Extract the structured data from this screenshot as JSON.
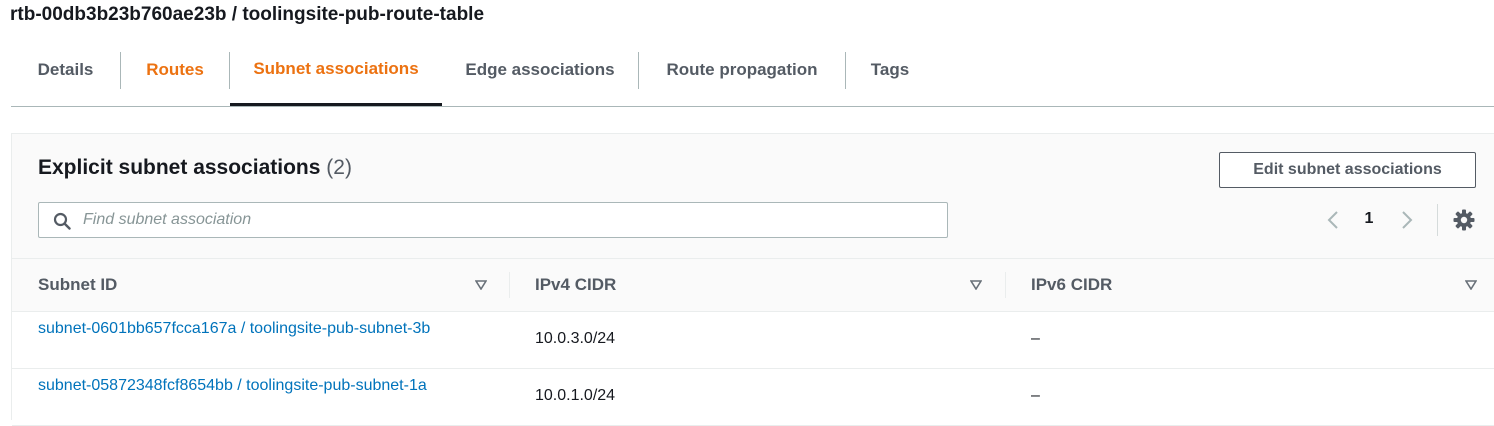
{
  "page": {
    "title": "rtb-00db3b23b760ae23b / toolingsite-pub-route-table"
  },
  "tabs": [
    {
      "label": "Details",
      "state": "default"
    },
    {
      "label": "Routes",
      "state": "highlighted"
    },
    {
      "label": "Subnet associations",
      "state": "active"
    },
    {
      "label": "Edge associations",
      "state": "default"
    },
    {
      "label": "Route propagation",
      "state": "default"
    },
    {
      "label": "Tags",
      "state": "default"
    }
  ],
  "section": {
    "title": "Explicit subnet associations",
    "count": "(2)",
    "edit_button": "Edit subnet associations"
  },
  "search": {
    "placeholder": "Find subnet association",
    "value": "",
    "icon": "search-icon"
  },
  "pagination": {
    "current_page": "1",
    "prev_icon": "chevron-left-icon",
    "next_icon": "chevron-right-icon",
    "settings_icon": "gear-icon"
  },
  "table": {
    "columns": [
      "Subnet ID",
      "IPv4 CIDR",
      "IPv6 CIDR"
    ],
    "rows": [
      {
        "subnet_id": "subnet-0601bb657fcca167a / toolingsite-pub-subnet-3b",
        "ipv4": "10.0.3.0/24",
        "ipv6": "–"
      },
      {
        "subnet_id": "subnet-05872348fcf8654bb / toolingsite-pub-subnet-1a",
        "ipv4": "10.0.1.0/24",
        "ipv6": "–"
      }
    ]
  },
  "colors": {
    "accent_orange": "#ec7211",
    "link_blue": "#0073bb",
    "text_dark": "#16191f",
    "text_muted": "#545b64"
  }
}
